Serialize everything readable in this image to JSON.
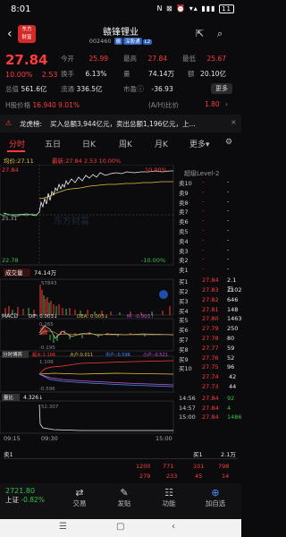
{
  "status": {
    "time": "8:01",
    "icons": "N ⊠ ⏰ ▾▴ ▮▮▮",
    "battery": "11"
  },
  "header": {
    "logo": "东方\n财富",
    "name": "赣锋锂业",
    "code": "002460",
    "tags": [
      "融",
      "深股通",
      "L2"
    ]
  },
  "quote": {
    "price": "27.84",
    "change_pct": "10.00%",
    "change": "2.53",
    "rows": [
      [
        {
          "l": "今开",
          "v": "25.99",
          "c": "red"
        },
        {
          "l": "最高",
          "v": "27.84",
          "c": "red"
        },
        {
          "l": "最低",
          "v": "25.67",
          "c": "red"
        }
      ],
      [
        {
          "l": "换手",
          "v": "6.13%",
          "c": "white"
        },
        {
          "l": "量",
          "v": "74.14万",
          "c": "white"
        },
        {
          "l": "额",
          "v": "20.10亿",
          "c": "white"
        }
      ],
      [
        {
          "l": "流通",
          "v": "336.5亿",
          "c": "white"
        },
        {
          "l": "市盈",
          "v": "-36.93",
          "c": "white"
        }
      ]
    ],
    "total_value_label": "总值",
    "total_value": "561.6亿",
    "more": "更多"
  },
  "hshare": {
    "label": "H股价格",
    "price": "16.940",
    "pct": "9.01%",
    "ah_label": "(A/H)比价",
    "ah": "1.80"
  },
  "lhb": {
    "label": "龙虎榜:",
    "text": "买入总额3,944亿元，卖出总额1,196亿元，上..."
  },
  "tabs": [
    "分时",
    "五日",
    "日K",
    "周K",
    "月K",
    "更多"
  ],
  "ma": {
    "label": "均价:",
    "value": "27.11",
    "latest_label": "最新:",
    "latest": "27.84",
    "chg": "2.53",
    "pct": "10.00%"
  },
  "chart_axis": {
    "top_left": "27.84",
    "top_right": "10.00%",
    "mid": "25.31",
    "bottom_left": "22.78",
    "bottom_right": "-10.00%"
  },
  "volume": {
    "label": "成交量",
    "value": "74.14万",
    "max": "57843"
  },
  "macd": {
    "label": "MACD",
    "dif": "DIF: 0.003↓",
    "dea": "DEA: 0.005↓",
    "m": "M: -0.003↑",
    "top": "0.265",
    "bottom": "-0.195"
  },
  "flow": {
    "label": "分时博弈",
    "sup": "超大:1.106",
    "big": "大户:0.011",
    "mid": "中户:-0.596",
    "small": "小户:-0.521",
    "top": "1.106",
    "bottom": "-0.596"
  },
  "ratio": {
    "label": "量比",
    "value": "4.326↓",
    "top": "52.307"
  },
  "time_axis": [
    "09:15",
    "09:30",
    "15:00"
  ],
  "level2": {
    "title": "超级Level-2",
    "sell": [
      [
        "卖10",
        "-",
        "-"
      ],
      [
        "卖9",
        "-",
        "-"
      ],
      [
        "卖8",
        "-",
        "-"
      ],
      [
        "卖7",
        "-",
        "-"
      ],
      [
        "卖6",
        "-",
        "-"
      ],
      [
        "卖5",
        "-",
        "-"
      ],
      [
        "卖4",
        "-",
        "-"
      ],
      [
        "卖3",
        "-",
        "-"
      ],
      [
        "卖2",
        "-",
        "-"
      ],
      [
        "卖1",
        "-",
        "-"
      ]
    ],
    "buy": [
      [
        "买1",
        "27.84",
        "2.1万"
      ],
      [
        "买2",
        "27.83",
        "1102"
      ],
      [
        "买3",
        "27.82",
        "646"
      ],
      [
        "买4",
        "27.81",
        "148"
      ],
      [
        "买5",
        "27.80",
        "1463"
      ],
      [
        "买6",
        "27.79",
        "250"
      ],
      [
        "买7",
        "27.78",
        "80"
      ],
      [
        "买8",
        "27.77",
        "59"
      ],
      [
        "买9",
        "27.76",
        "52"
      ],
      [
        "买10",
        "27.75",
        "96"
      ]
    ],
    "extra": [
      [
        "27.74",
        "42"
      ],
      [
        "27.73",
        "44"
      ]
    ],
    "ticks": [
      [
        "14:56",
        "27.84",
        "92"
      ],
      [
        "14:57",
        "27.84",
        "4"
      ],
      [
        "15:00",
        "27.84",
        "1486"
      ]
    ]
  },
  "orderbook": {
    "sell_label": "卖1",
    "buy_label": "买1",
    "buy_value": "2.1万",
    "row1": [
      "1200",
      "771",
      "101",
      "798"
    ],
    "row2": [
      "279",
      "233",
      "45",
      "14"
    ]
  },
  "index": {
    "value": "2721.80",
    "name": "上证",
    "pct": "-0.82%"
  },
  "nav": [
    "交易",
    "发贴",
    "功能",
    "加自选"
  ],
  "nav_icons": [
    "trade-icon",
    "post-icon",
    "function-icon",
    "add-watch-icon"
  ]
}
